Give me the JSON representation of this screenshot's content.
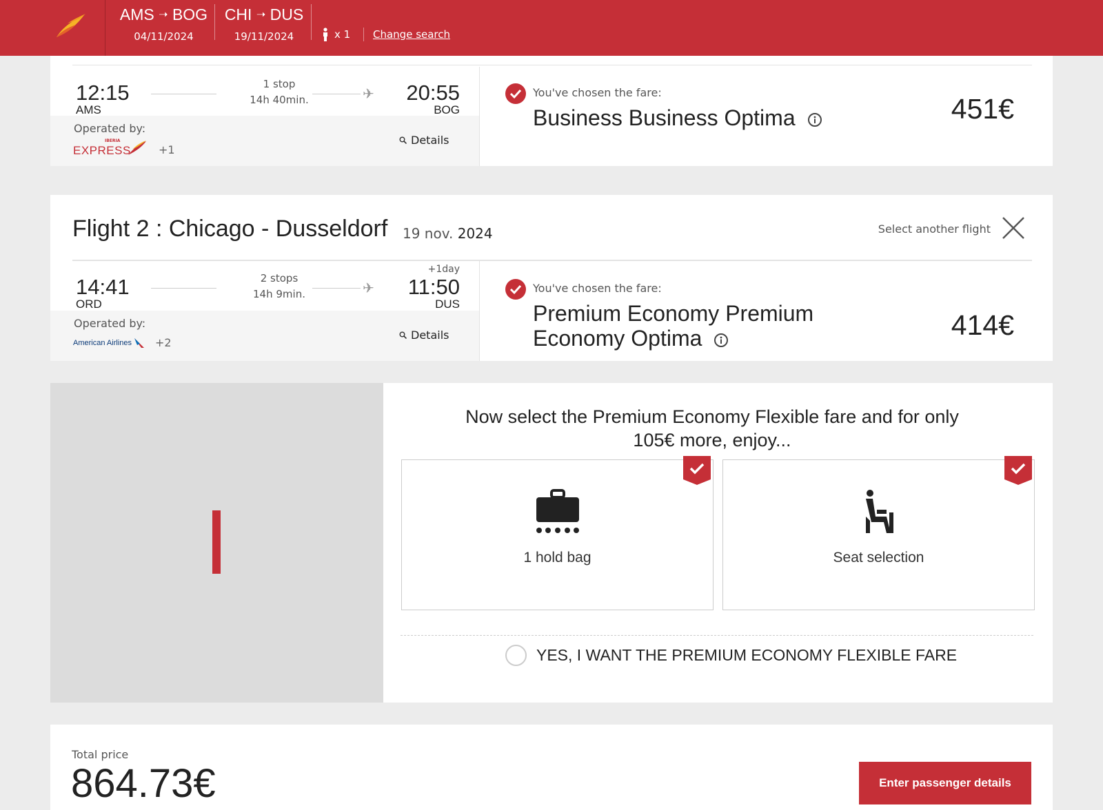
{
  "colors": {
    "brand_red": "#c52f37",
    "page_bg": "#ececec",
    "panel_grey": "#f5f5f5"
  },
  "header": {
    "routes": [
      {
        "origin": "AMS",
        "destination": "BOG",
        "date": "04/11/2024"
      },
      {
        "origin": "CHI",
        "destination": "DUS",
        "date": "19/11/2024"
      }
    ],
    "route_arrow": "→",
    "passengers": "x 1",
    "change_search": "Change search",
    "logo_icon": "iberia-logo-icon"
  },
  "flight1": {
    "dep_time": "12:15",
    "dep_code": "AMS",
    "stops": "1 stop",
    "duration": "14h 40min.",
    "arr_time": "20:55",
    "arr_code": "BOG",
    "operated_by_label": "Operated by:",
    "operator_logo_text": "EXPRESS",
    "operator_logo_small": "IBERIA",
    "operator_more": "+1",
    "details": "Details",
    "fare_label": "You've chosen the fare:",
    "fare_name": "Business Business Optima",
    "price": "451€"
  },
  "flight2": {
    "title": "Flight 2 : Chicago - Dusseldorf",
    "date_day": "19 nov.",
    "date_year": "2024",
    "select_another": "Select another flight",
    "dep_time": "14:41",
    "dep_code": "ORD",
    "stops": "2 stops",
    "duration": "14h 9min.",
    "plus_day": "+1day",
    "arr_time": "11:50",
    "arr_code": "DUS",
    "operated_by_label": "Operated by:",
    "operator_logo_text": "American Airlines",
    "operator_more": "+2",
    "details": "Details",
    "fare_label": "You've chosen the fare:",
    "fare_name_line1": "Premium Economy Premium",
    "fare_name_line2": "Economy Optima",
    "price": "414€"
  },
  "upsell": {
    "title_line1": "Now select the Premium Economy Flexible fare and for only",
    "title_line2": "105€ more, enjoy...",
    "benefits": [
      {
        "label": "1 hold bag",
        "icon": "hold-bag-icon"
      },
      {
        "label": "Seat selection",
        "icon": "seat-icon"
      }
    ],
    "opt_in_label": "YES, I WANT THE PREMIUM ECONOMY FLEXIBLE FARE"
  },
  "total": {
    "label": "Total price",
    "price": "864.73€",
    "cta": "Enter passenger details"
  }
}
